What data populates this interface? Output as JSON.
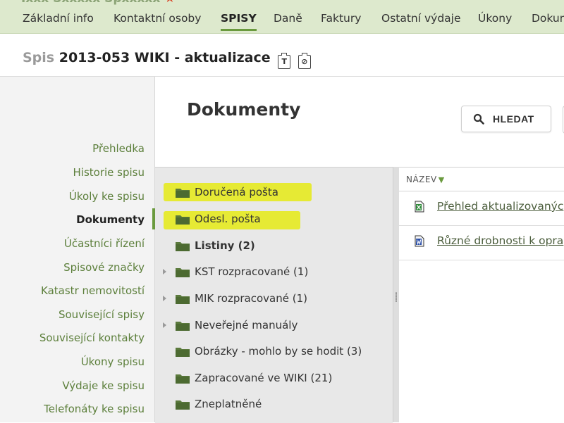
{
  "company": {
    "name": "Ixxx Sxxxxx Spxxxxx",
    "star": "★"
  },
  "tabs": [
    {
      "label": "Základní info",
      "active": false
    },
    {
      "label": "Kontaktní osoby",
      "active": false
    },
    {
      "label": "SPISY",
      "active": true
    },
    {
      "label": "Daně",
      "active": false
    },
    {
      "label": "Faktury",
      "active": false
    },
    {
      "label": "Ostatní výdaje",
      "active": false
    },
    {
      "label": "Úkony",
      "active": false
    },
    {
      "label": "Dokum",
      "active": false
    }
  ],
  "header": {
    "prefix": "Spis",
    "title": "2013-053 WIKI - aktualizace",
    "icon1_glyph": "T",
    "icon2_glyph": "⊘"
  },
  "sidebar": {
    "items": [
      {
        "label": "Přehledka",
        "active": false
      },
      {
        "label": "Historie spisu",
        "active": false
      },
      {
        "label": "Úkoly ke spisu",
        "active": false
      },
      {
        "label": "Dokumenty",
        "active": true
      },
      {
        "label": "Účastníci řízení",
        "active": false
      },
      {
        "label": "Spisové značky",
        "active": false
      },
      {
        "label": "Katastr nemovitostí",
        "active": false
      },
      {
        "label": "Související spisy",
        "active": false
      },
      {
        "label": "Související kontakty",
        "active": false
      },
      {
        "label": "Úkony spisu",
        "active": false
      },
      {
        "label": "Výdaje ke spisu",
        "active": false
      },
      {
        "label": "Telefonáty ke spisu",
        "active": false
      }
    ]
  },
  "main": {
    "heading": "Dokumenty",
    "search_label": "HLEDAT"
  },
  "folders": [
    {
      "label": "Doručená pošta",
      "expandable": false,
      "bold": false,
      "highlighted": true
    },
    {
      "label": "Odesl. pošta",
      "expandable": false,
      "bold": false,
      "highlighted": true
    },
    {
      "label": "Listiny (2)",
      "expandable": false,
      "bold": true,
      "highlighted": false
    },
    {
      "label": "KST rozpracované (1)",
      "expandable": true,
      "bold": false,
      "highlighted": false
    },
    {
      "label": "MIK rozpracované (1)",
      "expandable": true,
      "bold": false,
      "highlighted": false
    },
    {
      "label": "Neveřejné manuály",
      "expandable": true,
      "bold": false,
      "highlighted": false
    },
    {
      "label": "Obrázky - mohlo by se hodit (3)",
      "expandable": false,
      "bold": false,
      "highlighted": false
    },
    {
      "label": "Zapracované ve WIKI (21)",
      "expandable": false,
      "bold": false,
      "highlighted": false
    },
    {
      "label": "Zneplatněné",
      "expandable": false,
      "bold": false,
      "highlighted": false
    }
  ],
  "documents": {
    "column_name": "NÁZEV",
    "sort_arrow": "▼",
    "items": [
      {
        "title": "Přehled aktualizovanýc",
        "icon": "excel-file-icon"
      },
      {
        "title": "Různé drobnosti k opra",
        "icon": "word-file-icon"
      }
    ]
  },
  "colors": {
    "accent_green": "#6a9a3e",
    "link_green": "#5c7f3b",
    "highlight_yellow": "#e5ea14",
    "folder_green": "#5b7a3c"
  }
}
